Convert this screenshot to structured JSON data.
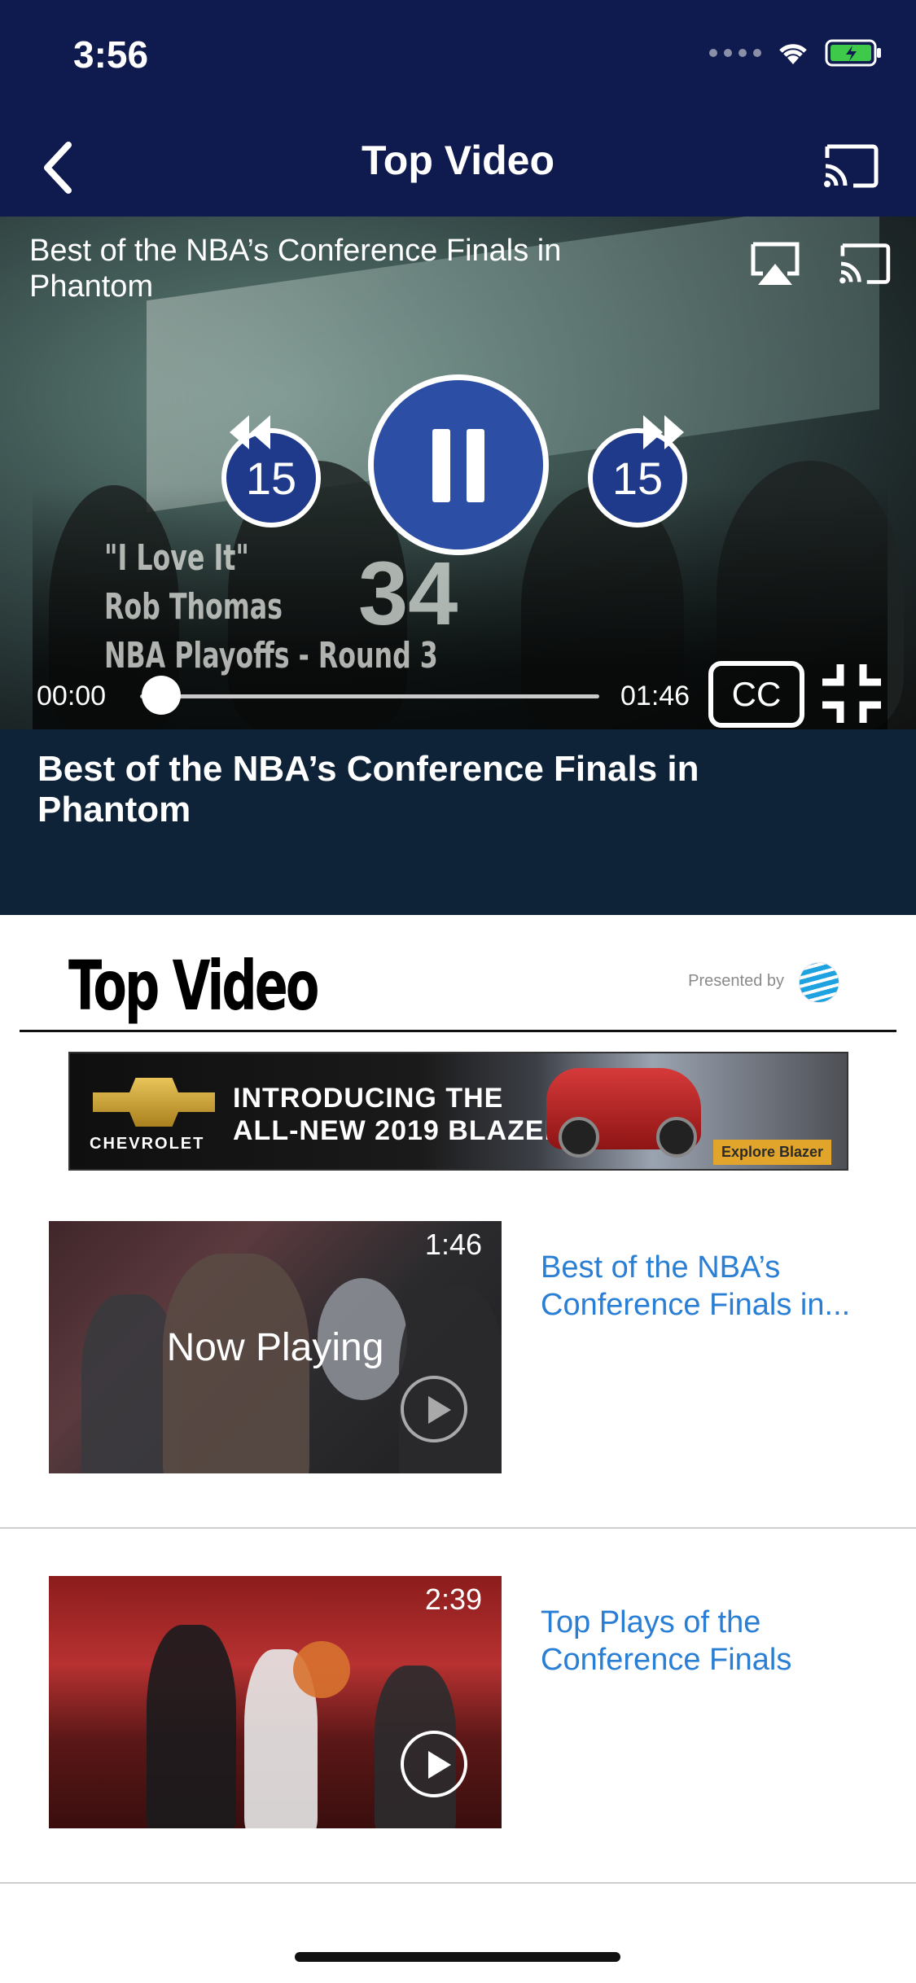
{
  "status_bar": {
    "time": "3:56"
  },
  "nav": {
    "title": "Top Video"
  },
  "player": {
    "overlay_title": "Best of the NBA’s Conference Finals in Phantom",
    "credit_lines": [
      "\"I Love It\"",
      "Rob Thomas",
      "NBA Playoffs - Round 3"
    ],
    "jersey_number": "34",
    "skip_back": "15",
    "skip_forward": "15",
    "current_time": "00:00",
    "duration": "01:46",
    "cc_label": "CC",
    "progress": 0.0
  },
  "info": {
    "title": "Best of the NBA’s Conference Finals in Phantom"
  },
  "section": {
    "title": "Top Video",
    "presented_by": "Presented by"
  },
  "ad": {
    "brand": "CHEVROLET",
    "line1": "INTRODUCING THE",
    "line2": "ALL-NEW 2019 BLAZER.",
    "cta": "Explore Blazer"
  },
  "videos": [
    {
      "duration": "1:46",
      "overlay": "Now Playing",
      "title": "Best of the NBA’s Conference Finals in..."
    },
    {
      "duration": "2:39",
      "overlay": "",
      "title": "Top Plays of the Conference Finals"
    }
  ]
}
